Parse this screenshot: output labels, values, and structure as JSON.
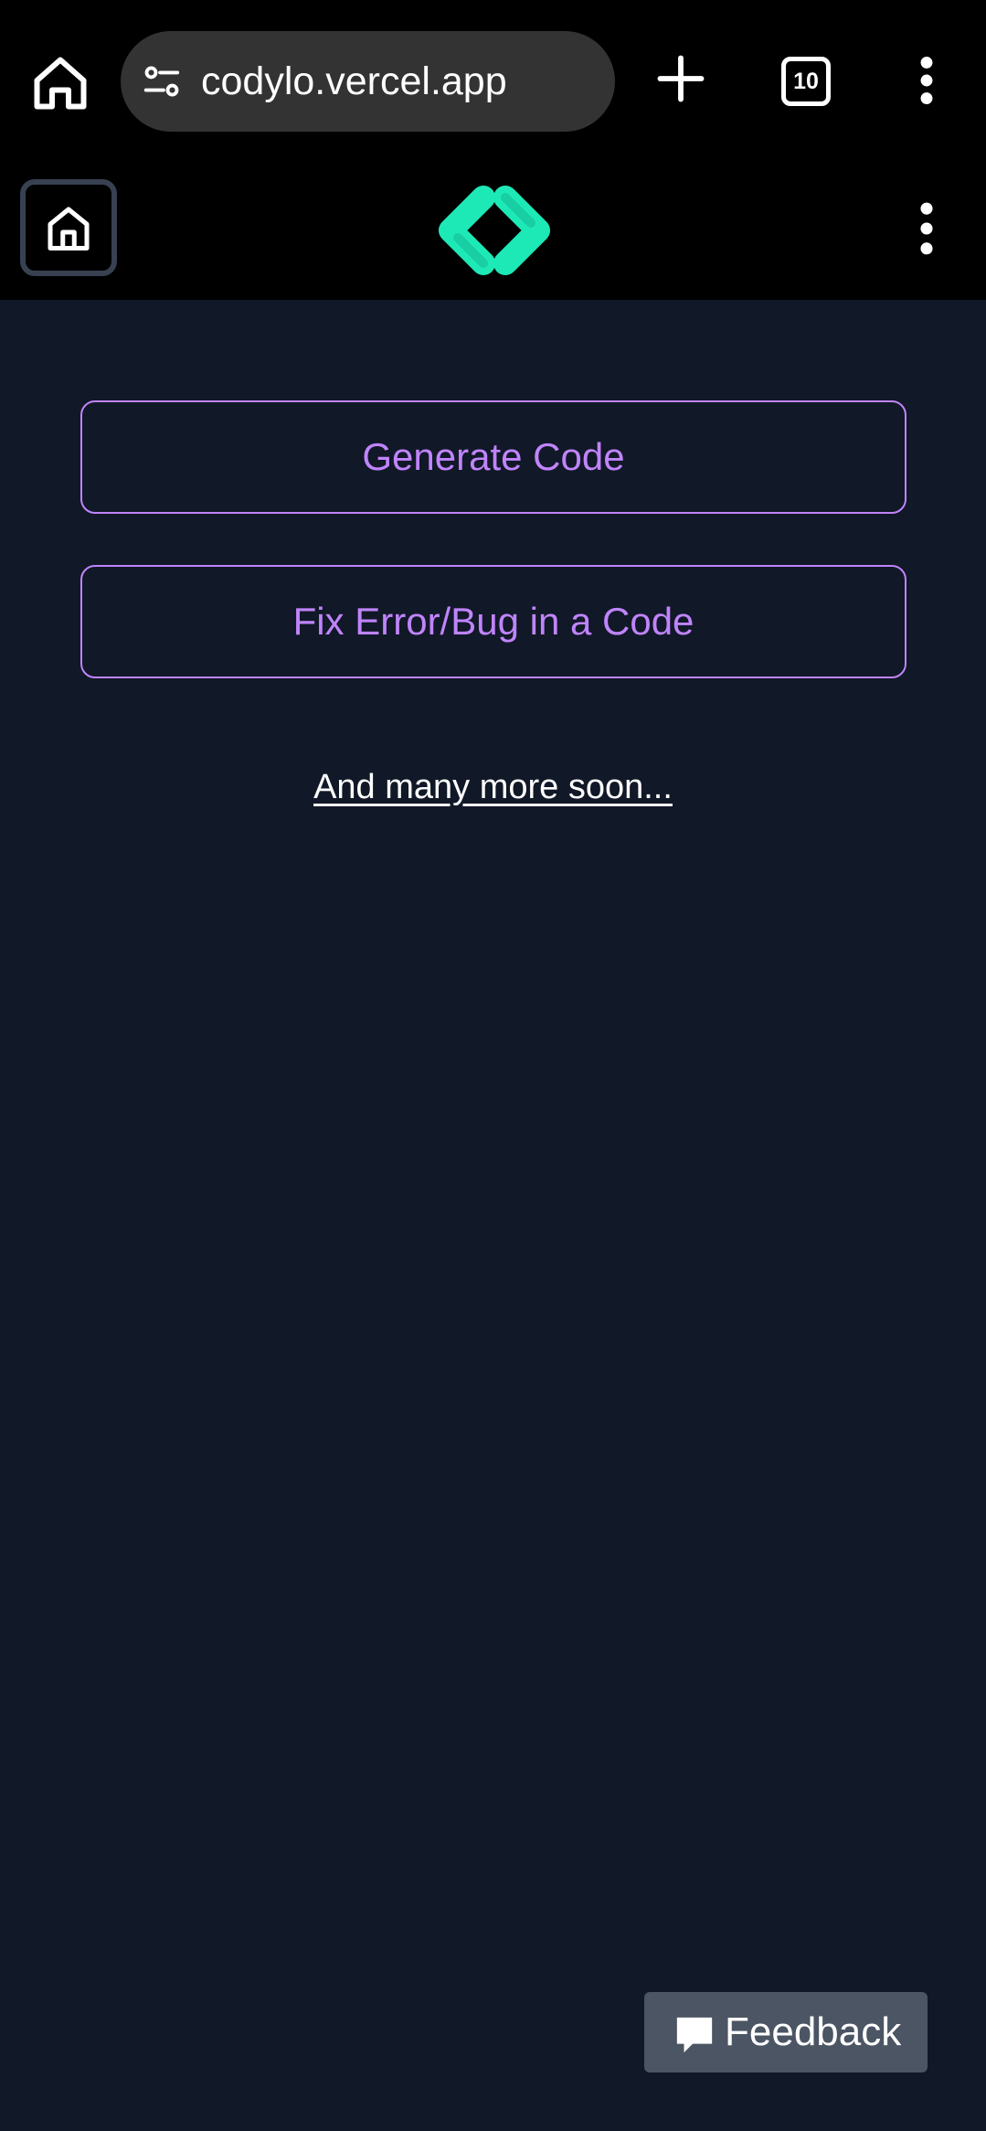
{
  "browser": {
    "url": "codylo.vercel.app",
    "tab_count": "10",
    "icons": [
      "home-icon",
      "site-settings-icon",
      "new-tab-icon",
      "tab-switcher-icon",
      "more-vert-icon"
    ]
  },
  "header": {
    "icons": [
      "home-icon",
      "logo-brackets-icon",
      "more-vert-icon"
    ]
  },
  "main": {
    "options": [
      {
        "label": "Generate Code"
      },
      {
        "label": "Fix Error/Bug in a Code"
      }
    ],
    "more_text": "And many more soon..."
  },
  "feedback": {
    "label": "Feedback",
    "icon": "chat-bubble-icon"
  },
  "colors": {
    "page_bg": "#111827",
    "bar_bg": "#000000",
    "accent_purple": "#c084fc",
    "logo_green": "#1de9b6",
    "feedback_bg": "#4b5563"
  }
}
